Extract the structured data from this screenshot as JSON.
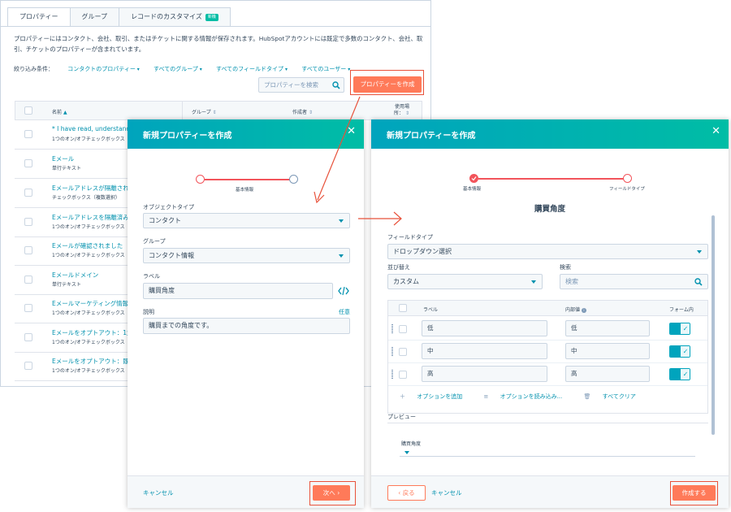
{
  "colors": {
    "accent": "#ff7a59",
    "teal": "#00a4bd",
    "link": "#0091ae",
    "annotation": "#e8523b"
  },
  "bg": {
    "tabs": [
      {
        "label": "プロパティー"
      },
      {
        "label": "グループ"
      },
      {
        "label": "レコードのカスタマイズ",
        "badge": "新機"
      }
    ],
    "description": "プロパティーにはコンタクト、会社、取引、またはチケットに関する情報が保存されます。HubSpotアカウントには既定で多数のコンタクト、会社、取引、チケットのプロパティーが含まれています。",
    "filter_label": "絞り込み条件：",
    "filters": [
      "コンタクトのプロパティー",
      "すべてのグループ",
      "すべてのフィールドタイプ",
      "すべてのユーザー"
    ],
    "search_placeholder": "プロパティーを検索",
    "create_button": "プロパティーを作成",
    "columns": {
      "name": "名前",
      "group": "グループ",
      "creator": "作成者",
      "used_line1": "使用場",
      "used_line2": "所："
    },
    "rows": [
      {
        "name": "* I have read, understand and",
        "type": "1つのオン/オフチェックボックス"
      },
      {
        "name": "Eメール",
        "type": "単行テキスト"
      },
      {
        "name": "Eメールアドレスが隔離された",
        "type": "チェックボックス（複数選択）"
      },
      {
        "name": "Eメールアドレスを隔離済み",
        "type": "1つのオン/オフチェックボックス"
      },
      {
        "name": "Eメールが確認されました",
        "type": "1つのオン/オフチェックボックス"
      },
      {
        "name": "Eメールドメイン",
        "type": "単行テキスト"
      },
      {
        "name": "Eメールマーケティング情報を",
        "type": "1つのオン/オフチェックボックス"
      },
      {
        "name": "Eメールをオプトアウト：1対1",
        "type": "1つのオン/オフチェックボックス"
      },
      {
        "name": "Eメールをオプトアウト：既定",
        "type": "1つのオン/オフチェックボックス"
      }
    ]
  },
  "modal1": {
    "title": "新規プロパティーを作成",
    "step_label": "基本情報",
    "object_type_label": "オブジェクトタイプ",
    "object_type_value": "コンタクト",
    "group_label": "グループ",
    "group_value": "コンタクト情報",
    "label_label": "ラベル",
    "label_value": "購買角度",
    "desc_label": "説明",
    "optional": "任意",
    "desc_value": "購買までの角度です。",
    "cancel": "キャンセル",
    "next": "次へ"
  },
  "modal2": {
    "title": "新規プロパティーを作成",
    "step1_label": "基本情報",
    "step2_label": "フィールドタイプ",
    "heading": "購買角度",
    "field_type_label": "フィールドタイプ",
    "field_type_value": "ドロップダウン選択",
    "sort_label": "並び替え",
    "sort_value": "カスタム",
    "search_label": "検索",
    "search_placeholder": "検索",
    "table_head": {
      "label": "ラベル",
      "internal": "内部値",
      "form": "フォーム内"
    },
    "options": [
      {
        "label": "低",
        "internal": "低"
      },
      {
        "label": "中",
        "internal": "中"
      },
      {
        "label": "高",
        "internal": "高"
      }
    ],
    "add_option": "オプションを追加",
    "load_options": "オプションを読み込み...",
    "clear_all": "すべてクリア",
    "preview_label": "プレビュー",
    "preview_field_label": "購買角度",
    "back": "戻る",
    "cancel": "キャンセル",
    "create": "作成する"
  }
}
